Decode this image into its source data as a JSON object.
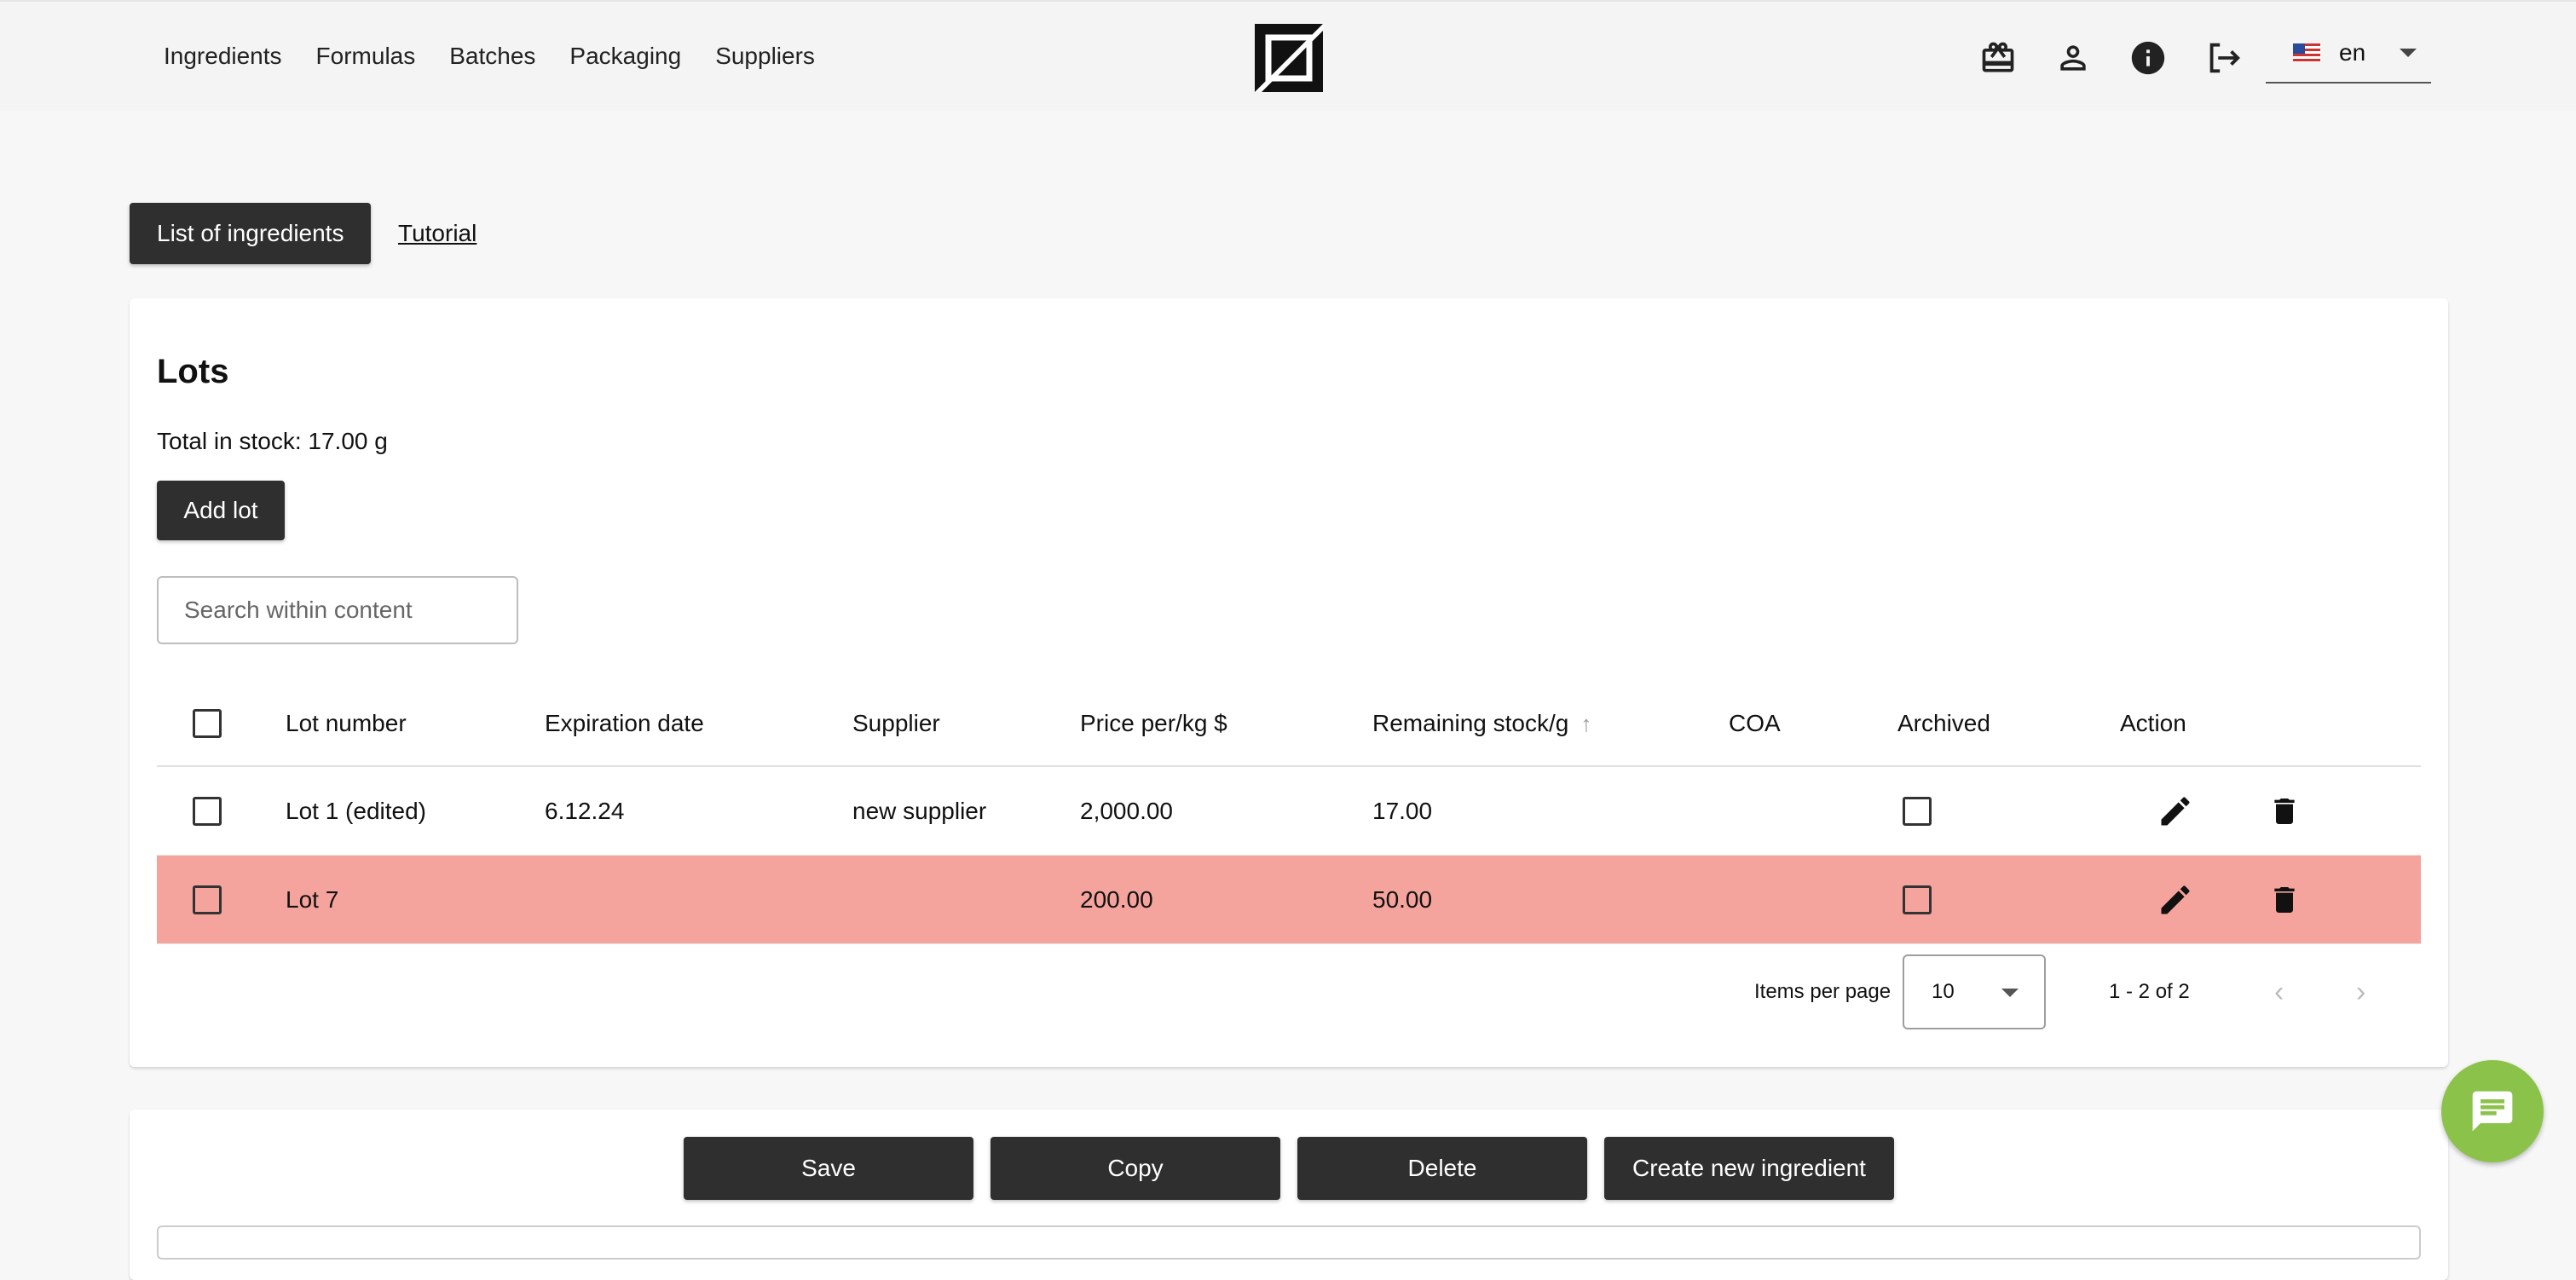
{
  "nav": {
    "items": [
      "Ingredients",
      "Formulas",
      "Batches",
      "Packaging",
      "Suppliers"
    ]
  },
  "header": {
    "language": "en"
  },
  "tabs": {
    "active": "List of ingredients",
    "link": "Tutorial"
  },
  "lots": {
    "title": "Lots",
    "total_in_stock": "Total in stock: 17.00 g",
    "add_button": "Add lot",
    "search_placeholder": "Search within content",
    "columns": [
      "Lot number",
      "Expiration date",
      "Supplier",
      "Price per/kg $",
      "Remaining stock/g",
      "COA",
      "Archived",
      "Action"
    ],
    "rows": [
      {
        "lot": "Lot 1 (edited)",
        "expiration": "6.12.24",
        "supplier": "new supplier",
        "price": "2,000.00",
        "stock": "17.00",
        "coa": "",
        "archived": false,
        "highlight": false
      },
      {
        "lot": "Lot 7",
        "expiration": "",
        "supplier": "",
        "price": "200.00",
        "stock": "50.00",
        "coa": "",
        "archived": false,
        "highlight": true
      }
    ],
    "pagination": {
      "items_per_page_label": "Items per page",
      "items_per_page": "10",
      "range": "1 - 2 of 2"
    }
  },
  "actions": {
    "save": "Save",
    "copy": "Copy",
    "delete": "Delete",
    "create": "Create new ingredient"
  },
  "colors": {
    "dark": "#2f2f2f",
    "highlight_row": "#f5a49d",
    "chat": "#8bc34a"
  }
}
